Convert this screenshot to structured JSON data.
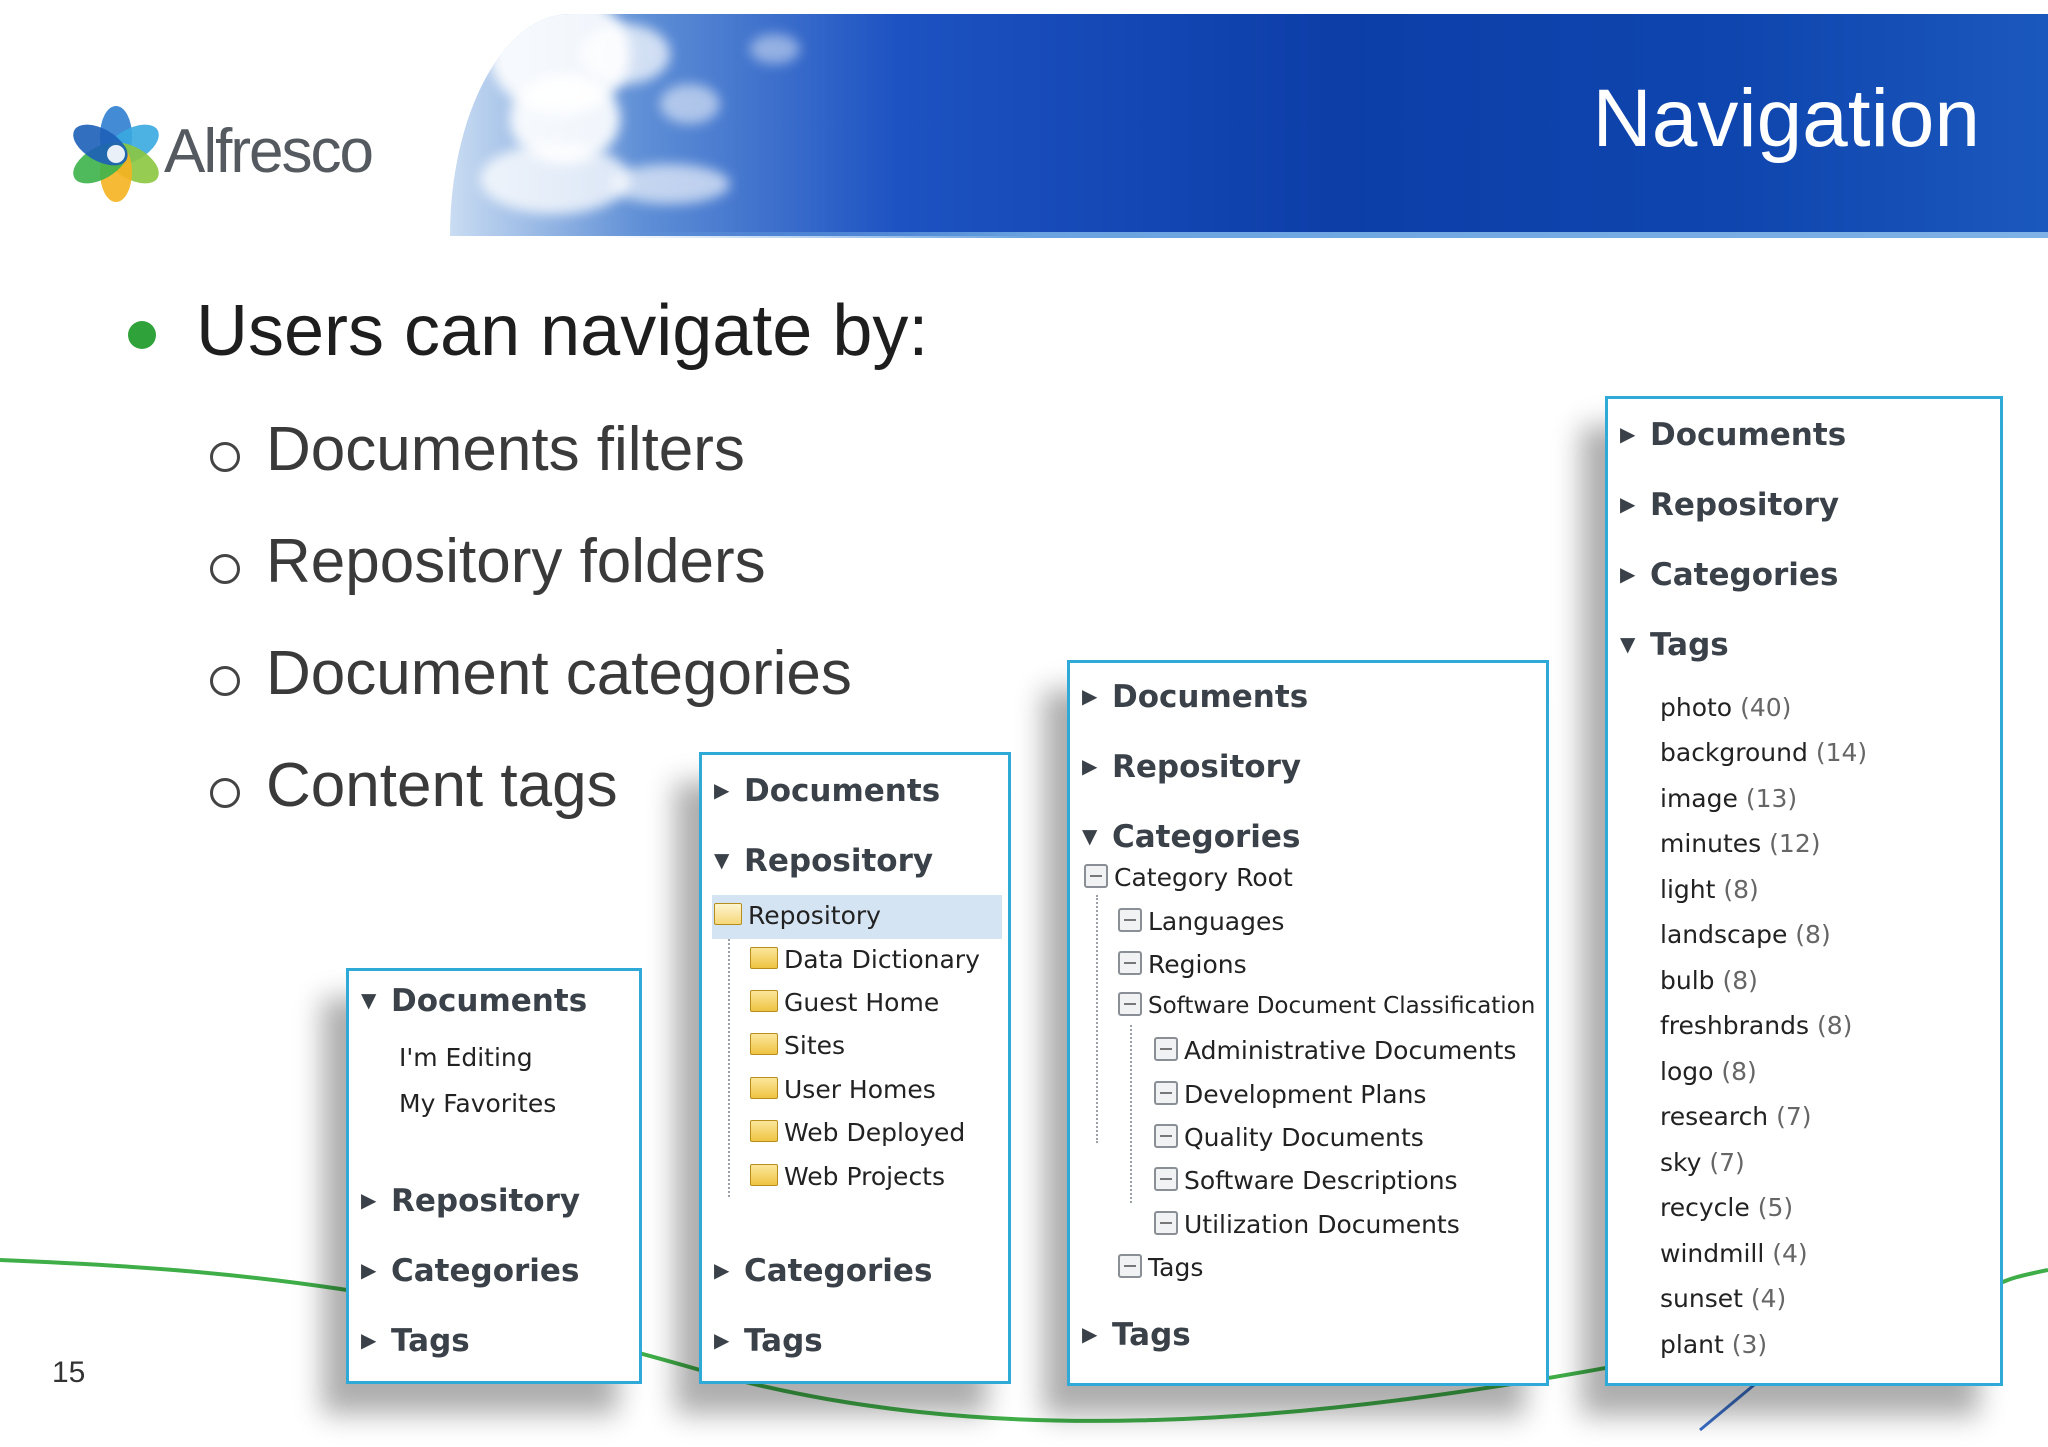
{
  "header": {
    "title": "Navigation",
    "logo_text": "Alfresco",
    "accent_color": "#0d3ea8"
  },
  "bullets": {
    "main": "Users can navigate by:",
    "subs": [
      "Documents filters",
      "Repository folders",
      "Document categories",
      "Content tags"
    ]
  },
  "panel_documents": {
    "sections": [
      "Documents",
      "Repository",
      "Categories",
      "Tags"
    ],
    "items": [
      "I'm Editing",
      "My Favorites"
    ]
  },
  "panel_repository": {
    "sections": [
      "Documents",
      "Repository",
      "Categories",
      "Tags"
    ],
    "root": "Repository",
    "folders": [
      "Data Dictionary",
      "Guest Home",
      "Sites",
      "User Homes",
      "Web Deployed",
      "Web Projects"
    ]
  },
  "panel_categories": {
    "sections": [
      "Documents",
      "Repository",
      "Categories",
      "Tags"
    ],
    "root": "Category Root",
    "level1": [
      "Languages",
      "Regions",
      "Software Document Classification",
      "Tags"
    ],
    "level2": [
      "Administrative Documents",
      "Development Plans",
      "Quality Documents",
      "Software Descriptions",
      "Utilization Documents"
    ]
  },
  "panel_tags": {
    "sections": [
      "Documents",
      "Repository",
      "Categories",
      "Tags"
    ],
    "tags": [
      {
        "name": "photo",
        "count": "(40)"
      },
      {
        "name": "background",
        "count": "(14)"
      },
      {
        "name": "image",
        "count": "(13)"
      },
      {
        "name": "minutes",
        "count": "(12)"
      },
      {
        "name": "light",
        "count": "(8)"
      },
      {
        "name": "landscape",
        "count": "(8)"
      },
      {
        "name": "bulb",
        "count": "(8)"
      },
      {
        "name": "freshbrands",
        "count": "(8)"
      },
      {
        "name": "logo",
        "count": "(8)"
      },
      {
        "name": "research",
        "count": "(7)"
      },
      {
        "name": "sky",
        "count": "(7)"
      },
      {
        "name": "recycle",
        "count": "(5)"
      },
      {
        "name": "windmill",
        "count": "(4)"
      },
      {
        "name": "sunset",
        "count": "(4)"
      },
      {
        "name": "plant",
        "count": "(3)"
      }
    ]
  },
  "footer": {
    "page_number": "15"
  }
}
